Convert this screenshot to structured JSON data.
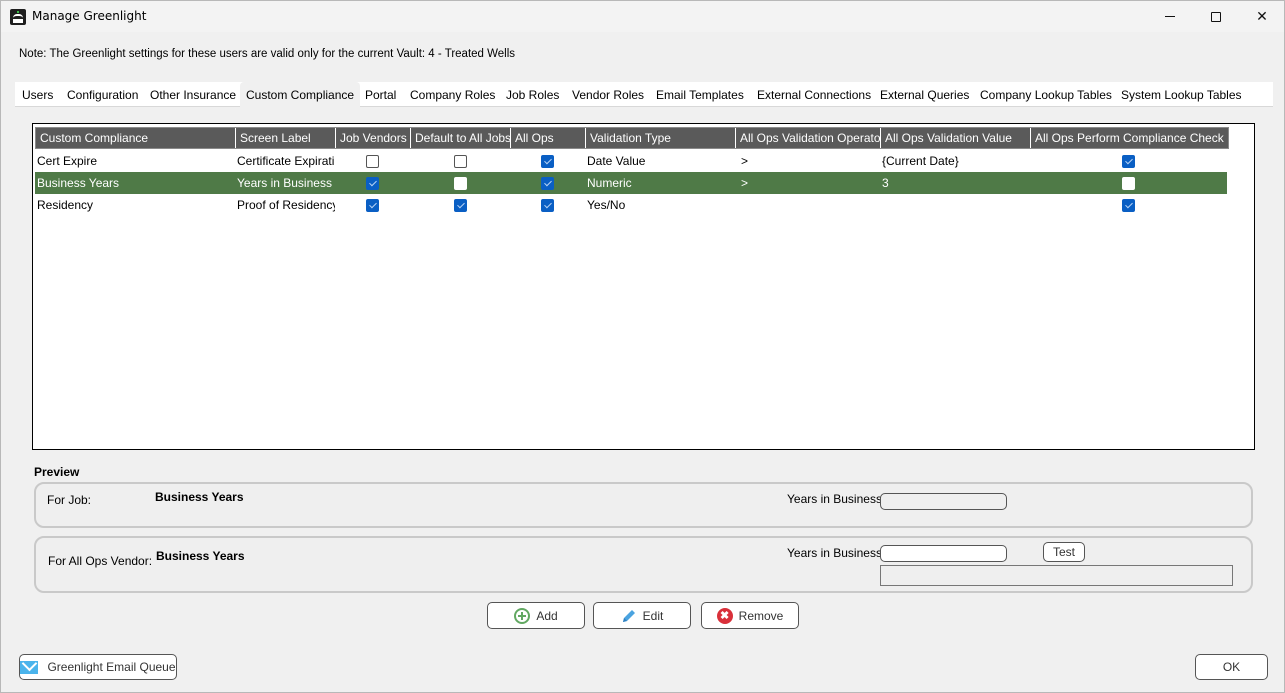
{
  "window": {
    "title": "Manage Greenlight",
    "minimize_label": "",
    "maximize_label": "",
    "close_label": "✕"
  },
  "note": "Note:  The Greenlight settings for these users are valid only for the current Vault: 4 - Treated Wells",
  "tabs": [
    {
      "label": "Users",
      "active": false
    },
    {
      "label": "Configuration",
      "active": false
    },
    {
      "label": "Other Insurance",
      "active": false
    },
    {
      "label": "Custom Compliance",
      "active": true
    },
    {
      "label": "Portal",
      "active": false
    },
    {
      "label": "Company Roles",
      "active": false
    },
    {
      "label": "Job Roles",
      "active": false
    },
    {
      "label": "Vendor Roles",
      "active": false
    },
    {
      "label": "Email Templates",
      "active": false
    },
    {
      "label": "External Connections",
      "active": false
    },
    {
      "label": "External Queries",
      "active": false
    },
    {
      "label": "Company Lookup Tables",
      "active": false
    },
    {
      "label": "System Lookup Tables",
      "active": false
    }
  ],
  "grid": {
    "columns": [
      "Custom Compliance",
      "Screen Label",
      "Job Vendors",
      "Default to All Jobs",
      "All Ops",
      "Validation Type",
      "All Ops Validation Operator",
      "All Ops Validation Value",
      "All Ops Perform Compliance Check"
    ],
    "rows": [
      {
        "name": "Cert Expire",
        "screen_label": "Certificate Expirati...",
        "job_vendors": false,
        "default_all_jobs": false,
        "all_ops": true,
        "validation_type": "Date Value",
        "operator": ">",
        "value": "{Current Date}",
        "perform_check": true,
        "selected": false
      },
      {
        "name": "Business Years",
        "screen_label": "Years in Business",
        "job_vendors": true,
        "default_all_jobs": false,
        "all_ops": true,
        "validation_type": "Numeric",
        "operator": ">",
        "value": "3",
        "perform_check": false,
        "selected": true
      },
      {
        "name": "Residency",
        "screen_label": "Proof of Residency",
        "job_vendors": true,
        "default_all_jobs": true,
        "all_ops": true,
        "validation_type": "Yes/No",
        "operator": "",
        "value": "",
        "perform_check": true,
        "selected": false
      }
    ],
    "colors": {
      "header_bg": "#5a5a5a",
      "selected_row_bg": "#4f7a47",
      "checkbox_checked": "#0a5fc4"
    }
  },
  "preview": {
    "title": "Preview",
    "for_job": {
      "label": "For Job:",
      "name": "Business Years",
      "field_label": "Years in Business",
      "field_value": ""
    },
    "for_all_ops": {
      "label": "For All Ops Vendor:",
      "name": "Business Years",
      "field_label": "Years in Business",
      "field_value": "",
      "test_label": "Test",
      "result": ""
    }
  },
  "actions": {
    "add_label": "Add",
    "edit_label": "Edit",
    "remove_label": "Remove",
    "remove_icon_glyph": "✖"
  },
  "footer": {
    "email_queue_label": "Greenlight Email Queue",
    "ok_label": "OK"
  }
}
